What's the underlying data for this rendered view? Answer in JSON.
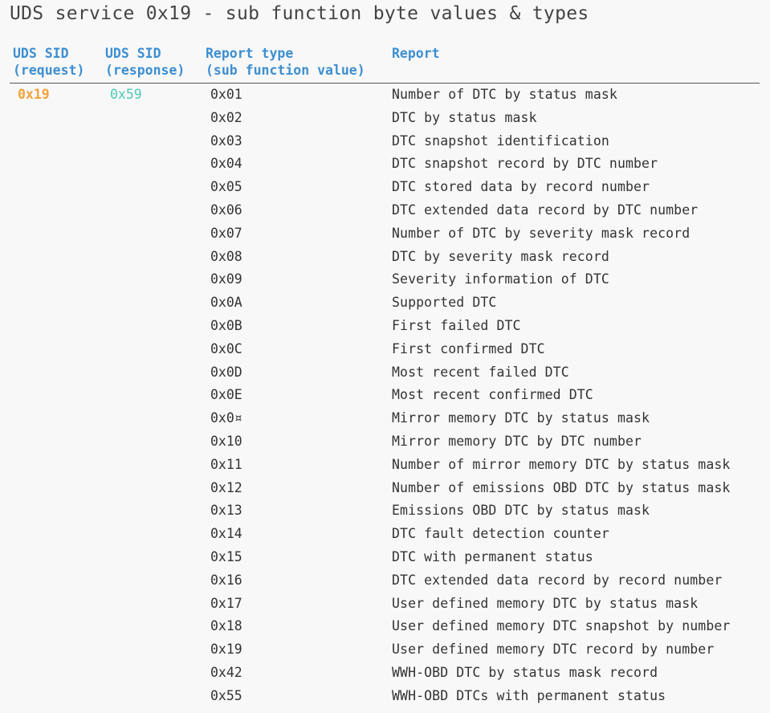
{
  "title": "UDS service 0x19 - sub function byte values & types",
  "headers": {
    "sid_request": [
      "UDS SID",
      "(request)"
    ],
    "sid_response": [
      "UDS SID",
      "(response)"
    ],
    "report_type": [
      "Report type",
      "(sub function value)"
    ],
    "report": [
      "Report"
    ]
  },
  "colors": {
    "header": "#3d8fd1",
    "request": "#f2a23a",
    "response": "#4ec9b8",
    "text": "#333333"
  },
  "rows": [
    {
      "req": "0x19",
      "resp": "0x59",
      "type": "0x01",
      "report": "Number of DTC by status mask"
    },
    {
      "req": "",
      "resp": "",
      "type": "0x02",
      "report": "DTC by status mask"
    },
    {
      "req": "",
      "resp": "",
      "type": "0x03",
      "report": "DTC snapshot identification"
    },
    {
      "req": "",
      "resp": "",
      "type": "0x04",
      "report": "DTC snapshot record by DTC number"
    },
    {
      "req": "",
      "resp": "",
      "type": "0x05",
      "report": "DTC stored data by record number"
    },
    {
      "req": "",
      "resp": "",
      "type": "0x06",
      "report": "DTC extended data record by DTC number"
    },
    {
      "req": "",
      "resp": "",
      "type": "0x07",
      "report": "Number of DTC by severity mask record"
    },
    {
      "req": "",
      "resp": "",
      "type": "0x08",
      "report": "DTC by severity mask record"
    },
    {
      "req": "",
      "resp": "",
      "type": "0x09",
      "report": "Severity information of DTC"
    },
    {
      "req": "",
      "resp": "",
      "type": "0x0A",
      "report": "Supported DTC"
    },
    {
      "req": "",
      "resp": "",
      "type": "0x0B",
      "report": "First failed DTC"
    },
    {
      "req": "",
      "resp": "",
      "type": "0x0C",
      "report": "First confirmed DTC"
    },
    {
      "req": "",
      "resp": "",
      "type": "0x0D",
      "report": "Most recent failed DTC"
    },
    {
      "req": "",
      "resp": "",
      "type": "0x0E",
      "report": "Most recent confirmed DTC"
    },
    {
      "req": "",
      "resp": "",
      "type": "0x0¤",
      "report": "Mirror memory DTC by status mask"
    },
    {
      "req": "",
      "resp": "",
      "type": "0x10",
      "report": "Mirror memory DTC by DTC number"
    },
    {
      "req": "",
      "resp": "",
      "type": "0x11",
      "report": "Number of mirror memory DTC by status mask"
    },
    {
      "req": "",
      "resp": "",
      "type": "0x12",
      "report": "Number of emissions OBD DTC by status mask"
    },
    {
      "req": "",
      "resp": "",
      "type": "0x13",
      "report": "Emissions OBD DTC by status mask"
    },
    {
      "req": "",
      "resp": "",
      "type": "0x14",
      "report": "DTC fault detection counter"
    },
    {
      "req": "",
      "resp": "",
      "type": "0x15",
      "report": "DTC with permanent status"
    },
    {
      "req": "",
      "resp": "",
      "type": "0x16",
      "report": "DTC extended data record by record number"
    },
    {
      "req": "",
      "resp": "",
      "type": "0x17",
      "report": "User defined memory DTC by status mask"
    },
    {
      "req": "",
      "resp": "",
      "type": "0x18",
      "report": "User defined memory DTC snapshot by number"
    },
    {
      "req": "",
      "resp": "",
      "type": "0x19",
      "report": "User defined memory DTC record by number"
    },
    {
      "req": "",
      "resp": "",
      "type": "0x42",
      "report": "WWH-OBD DTC by status mask record"
    },
    {
      "req": "",
      "resp": "",
      "type": "0x55",
      "report": "WWH-OBD DTCs with permanent status"
    }
  ]
}
